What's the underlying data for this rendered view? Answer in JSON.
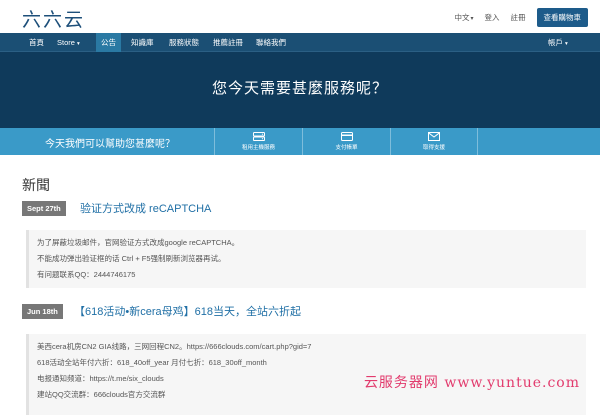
{
  "header": {
    "logo": "六六云",
    "lang_label": "中文",
    "login_label": "登入",
    "register_label": "註冊",
    "cart_label": "查看購物車"
  },
  "nav": {
    "items": [
      "首頁",
      "Store",
      "公告",
      "知識庫",
      "服務狀態",
      "推薦註冊",
      "聯絡我們"
    ],
    "active_index": 2,
    "account_label": "帳戶"
  },
  "hero": {
    "title": "您今天需要甚麼服務呢？"
  },
  "help_bar": {
    "question": "今天我們可以幫助您甚麼呢？",
    "items": [
      {
        "icon": "server-icon",
        "label": "租用主機服務"
      },
      {
        "icon": "credit-card-icon",
        "label": "支付帳單"
      },
      {
        "icon": "envelope-icon",
        "label": "取得支援"
      }
    ]
  },
  "news": {
    "title": "新聞",
    "posts": [
      {
        "date": "Sept 27th",
        "headline": "验证方式改成 reCAPTCHA",
        "lines": [
          "为了屏蔽垃圾邮件，官网验证方式改成google reCAPTCHA。",
          "不能成功弹出验证框的话 Ctrl + F5强制刷新浏览器再试。",
          "有问题联系QQ：2444746175"
        ]
      },
      {
        "date": "Jun 18th",
        "headline": "【618活动•新cera母鸡】618当天，全站六折起",
        "lines": [
          "美西cera机房CN2 GIA线路，三网回程CN2。https://666clouds.com/cart.php?gid=7",
          "618活动全站年付六折：618_40off_year   月付七折：618_30off_month",
          "电报通知频道：https://t.me/six_clouds",
          "建站QQ交流群：666clouds官方交流群"
        ]
      }
    ]
  },
  "watermark": "云服务器网 www.yuntue.com",
  "colors": {
    "nav_bg": "#1b4f74",
    "hero_bg": "#0f3a5b",
    "help_bar_bg": "#3a9ac8",
    "link": "#2170a6",
    "badge_bg": "#777777"
  }
}
